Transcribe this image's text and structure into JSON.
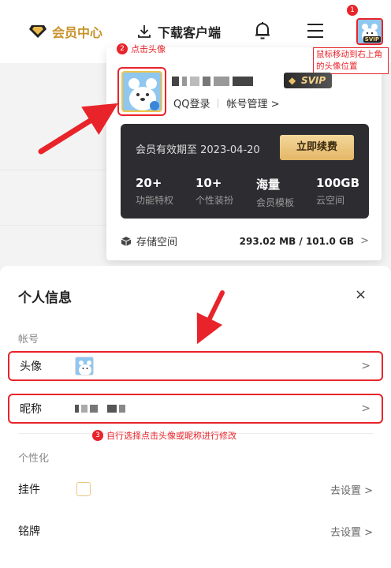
{
  "topbar": {
    "vip_center": "会员中心",
    "download_client": "下载客户端",
    "icons": [
      "diamond-icon",
      "download-icon",
      "bell-icon",
      "menu-icon"
    ]
  },
  "annotations": {
    "step1_number": "1",
    "step1_note": "鼠标移动到右上角的头像位置",
    "step2_number": "2",
    "step2_note": "点击头像",
    "step3_number": "3",
    "step3_note": "自行选择点击头像或昵称进行修改"
  },
  "dropdown": {
    "svip_tag": "SVIP",
    "qq_login": "QQ登录",
    "account_manage": "帐号管理 >",
    "vip_card": {
      "expire_text": "会员有效期至 2023-04-20",
      "renew_button": "立即续费",
      "stats": [
        {
          "value": "20+",
          "label": "功能特权"
        },
        {
          "value": "10+",
          "label": "个性装扮"
        },
        {
          "value": "海量",
          "label": "会员模板"
        },
        {
          "value": "100GB",
          "label": "云空间"
        }
      ]
    },
    "storage": {
      "label": "存储空间",
      "value": "293.02 MB / 101.0 GB",
      "chevron": ">"
    }
  },
  "personal_info": {
    "title": "个人信息",
    "close": "×",
    "account_section": "帐号",
    "avatar_label": "头像",
    "nickname_label": "昵称",
    "chevron": ">",
    "personalize_section": "个性化",
    "pendant_label": "挂件",
    "pendant_action": "去设置 >",
    "nameplate_label": "铭牌",
    "nameplate_action": "去设置 >"
  },
  "colors": {
    "accent_red": "#e8242a",
    "gold": "#c8922a",
    "card_dark": "#2d2d31"
  }
}
